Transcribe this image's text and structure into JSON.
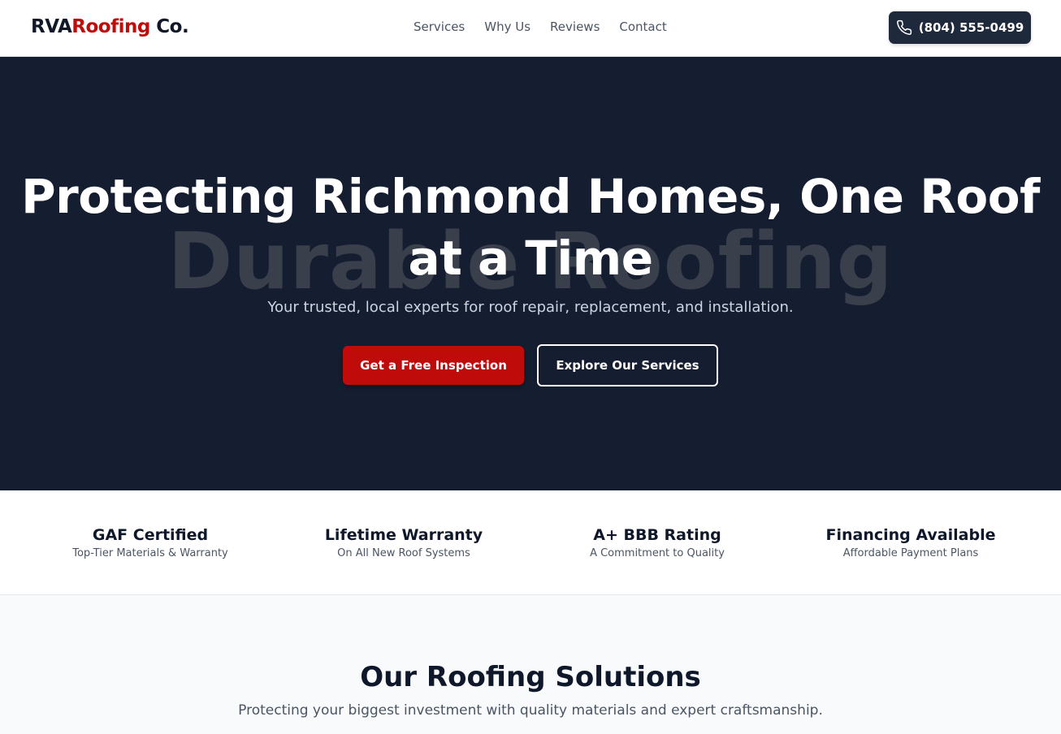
{
  "header": {
    "logo_part1": "RVA",
    "logo_part2": "Roofing",
    "logo_part3": " Co.",
    "nav": [
      "Services",
      "Why Us",
      "Reviews",
      "Contact"
    ],
    "phone_label": "(804) 555-0499",
    "phone_icon": "phone-icon"
  },
  "hero": {
    "background_word": "Durable Roofing",
    "title": "Protecting Richmond Homes, One Roof at a Time",
    "subtitle": "Your trusted, local experts for roof repair, replacement, and installation.",
    "primary_button": "Get a Free Inspection",
    "secondary_button": "Explore Our Services"
  },
  "features": [
    {
      "title": "GAF Certified",
      "desc": "Top-Tier Materials & Warranty"
    },
    {
      "title": "Lifetime Warranty",
      "desc": "On All New Roof Systems"
    },
    {
      "title": "A+ BBB Rating",
      "desc": "A Commitment to Quality"
    },
    {
      "title": "Financing Available",
      "desc": "Affordable Payment Plans"
    }
  ],
  "solutions": {
    "title": "Our Roofing Solutions",
    "subtitle": "Protecting your biggest investment with quality materials and expert craftsmanship."
  },
  "colors": {
    "accent_red": "#c00b0b",
    "hero_bg": "#151d30",
    "dark_button": "#1e293b"
  }
}
